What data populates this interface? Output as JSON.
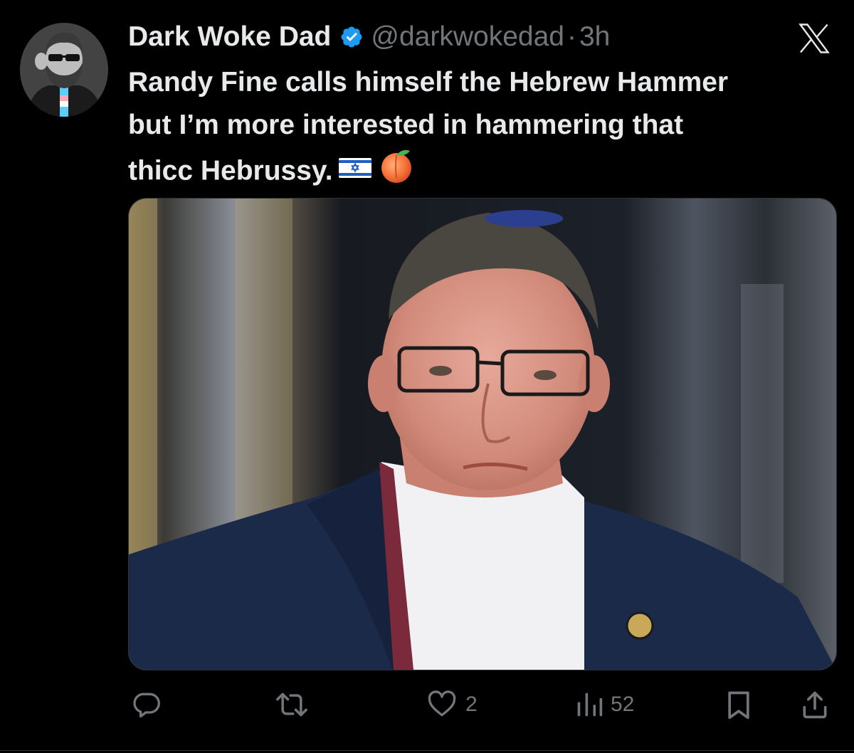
{
  "tweet": {
    "display_name": "Dark Woke Dad",
    "handle": "@darkwokedad",
    "separator": "·",
    "time": "3h",
    "text_lines": [
      "Randy Fine calls himself the Hebrew Hammer",
      "but I’m more interested in hammering that",
      "thicc Hebrussy."
    ],
    "emojis": [
      "israel-flag",
      "peach"
    ]
  },
  "actions": {
    "reply_count": "",
    "repost_count": "",
    "like_count": "2",
    "views_count": "52"
  },
  "colors": {
    "background": "#000000",
    "text_primary": "#e7e9ea",
    "text_secondary": "#71767b",
    "verified_blue": "#1d9bf0",
    "border": "#2f3336"
  },
  "icons": [
    "verified-badge-icon",
    "x-logo-icon",
    "reply-icon",
    "repost-icon",
    "like-icon",
    "views-icon",
    "bookmark-icon",
    "share-icon"
  ]
}
